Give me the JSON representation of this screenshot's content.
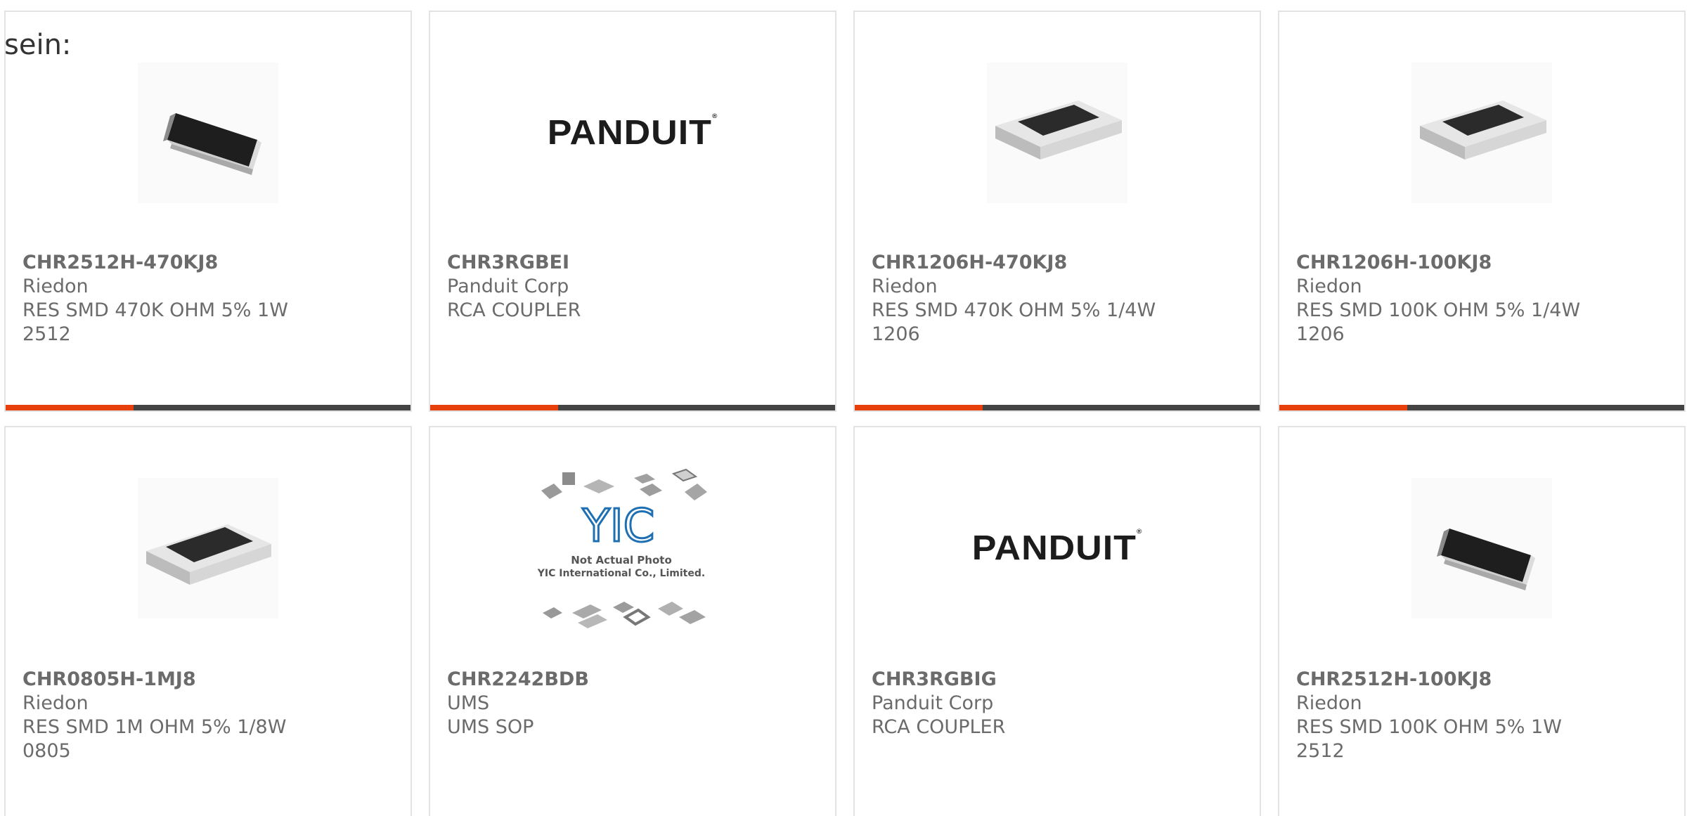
{
  "intro_text": "sein:",
  "colors": {
    "accent": "#e8400c",
    "bar": "#444444",
    "text": "#6b6b6b",
    "border": "#e3e3e3"
  },
  "products": [
    {
      "part_number": "CHR2512H-470KJ8",
      "manufacturer": "Riedon",
      "description": "RES SMD 470K OHM 5% 1W 2512",
      "image": "resistor-angled"
    },
    {
      "part_number": "CHR3RGBEI",
      "manufacturer": "Panduit Corp",
      "description": "RCA COUPLER",
      "image": "panduit-logo",
      "logo_text": "PANDUIT"
    },
    {
      "part_number": "CHR1206H-470KJ8",
      "manufacturer": "Riedon",
      "description": "RES SMD 470K OHM 5% 1/4W 1206",
      "image": "resistor-flat"
    },
    {
      "part_number": "CHR1206H-100KJ8",
      "manufacturer": "Riedon",
      "description": "RES SMD 100K OHM 5% 1/4W 1206",
      "image": "resistor-flat"
    },
    {
      "part_number": "CHR0805H-1MJ8",
      "manufacturer": "Riedon",
      "description": "RES SMD 1M OHM 5% 1/8W 0805",
      "image": "resistor-flat"
    },
    {
      "part_number": "CHR2242BDB",
      "manufacturer": "UMS",
      "description": "UMS SOP",
      "image": "yic-placeholder",
      "logo_text": "YIC",
      "photo_note": "Not Actual Photo",
      "photo_company": "YIC International Co., Limited."
    },
    {
      "part_number": "CHR3RGBIG",
      "manufacturer": "Panduit Corp",
      "description": "RCA COUPLER",
      "image": "panduit-logo",
      "logo_text": "PANDUIT"
    },
    {
      "part_number": "CHR2512H-100KJ8",
      "manufacturer": "Riedon",
      "description": "RES SMD 100K OHM 5% 1W 2512",
      "image": "resistor-angled"
    }
  ]
}
